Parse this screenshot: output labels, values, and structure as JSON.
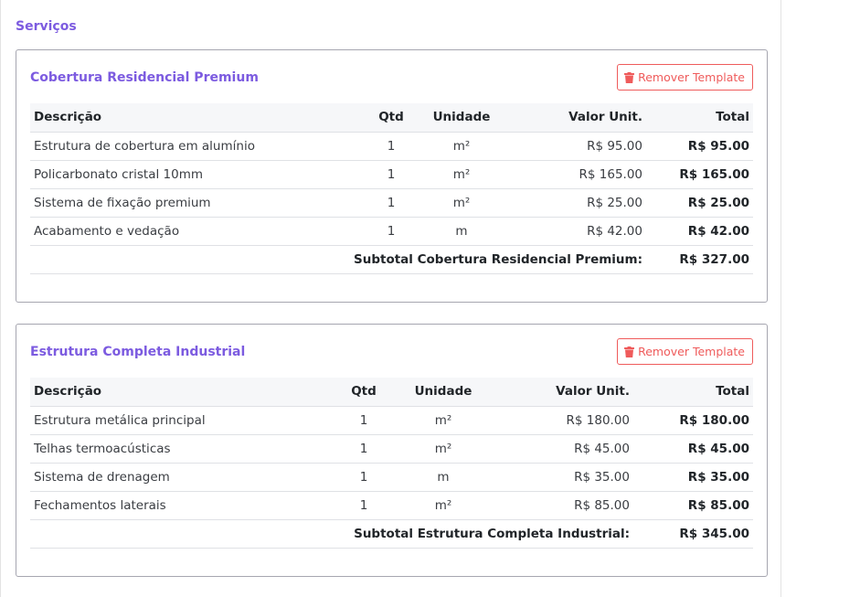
{
  "section_title": "Serviços",
  "templates": [
    {
      "title": "Cobertura Residencial Premium",
      "remove_label": "Remover Template",
      "headers": {
        "desc": "Descrição",
        "qtd": "Qtd",
        "unit": "Unidade",
        "unit_value": "Valor Unit.",
        "total": "Total"
      },
      "rows": [
        {
          "desc": "Estrutura de cobertura em alumínio",
          "qtd": "1",
          "unit": "m²",
          "unit_value": "R$ 95.00",
          "total": "R$ 95.00"
        },
        {
          "desc": "Policarbonato cristal 10mm",
          "qtd": "1",
          "unit": "m²",
          "unit_value": "R$ 165.00",
          "total": "R$ 165.00"
        },
        {
          "desc": "Sistema de fixação premium",
          "qtd": "1",
          "unit": "m²",
          "unit_value": "R$ 25.00",
          "total": "R$ 25.00"
        },
        {
          "desc": "Acabamento e vedação",
          "qtd": "1",
          "unit": "m",
          "unit_value": "R$ 42.00",
          "total": "R$ 42.00"
        }
      ],
      "subtotal_label": "Subtotal Cobertura Residencial Premium:",
      "subtotal_value": "R$ 327.00"
    },
    {
      "title": "Estrutura Completa Industrial",
      "remove_label": "Remover Template",
      "headers": {
        "desc": "Descrição",
        "qtd": "Qtd",
        "unit": "Unidade",
        "unit_value": "Valor Unit.",
        "total": "Total"
      },
      "rows": [
        {
          "desc": "Estrutura metálica principal",
          "qtd": "1",
          "unit": "m²",
          "unit_value": "R$ 180.00",
          "total": "R$ 180.00"
        },
        {
          "desc": "Telhas termoacústicas",
          "qtd": "1",
          "unit": "m²",
          "unit_value": "R$ 45.00",
          "total": "R$ 45.00"
        },
        {
          "desc": "Sistema de drenagem",
          "qtd": "1",
          "unit": "m",
          "unit_value": "R$ 35.00",
          "total": "R$ 35.00"
        },
        {
          "desc": "Fechamentos laterais",
          "qtd": "1",
          "unit": "m²",
          "unit_value": "R$ 85.00",
          "total": "R$ 85.00"
        }
      ],
      "subtotal_label": "Subtotal Estrutura Completa Industrial:",
      "subtotal_value": "R$ 345.00"
    }
  ],
  "colors": {
    "accent": "#7c5be0",
    "danger": "#ef5b5b",
    "header_bg": "#f6f7f9"
  },
  "icons": {
    "remove": "trash-icon"
  }
}
